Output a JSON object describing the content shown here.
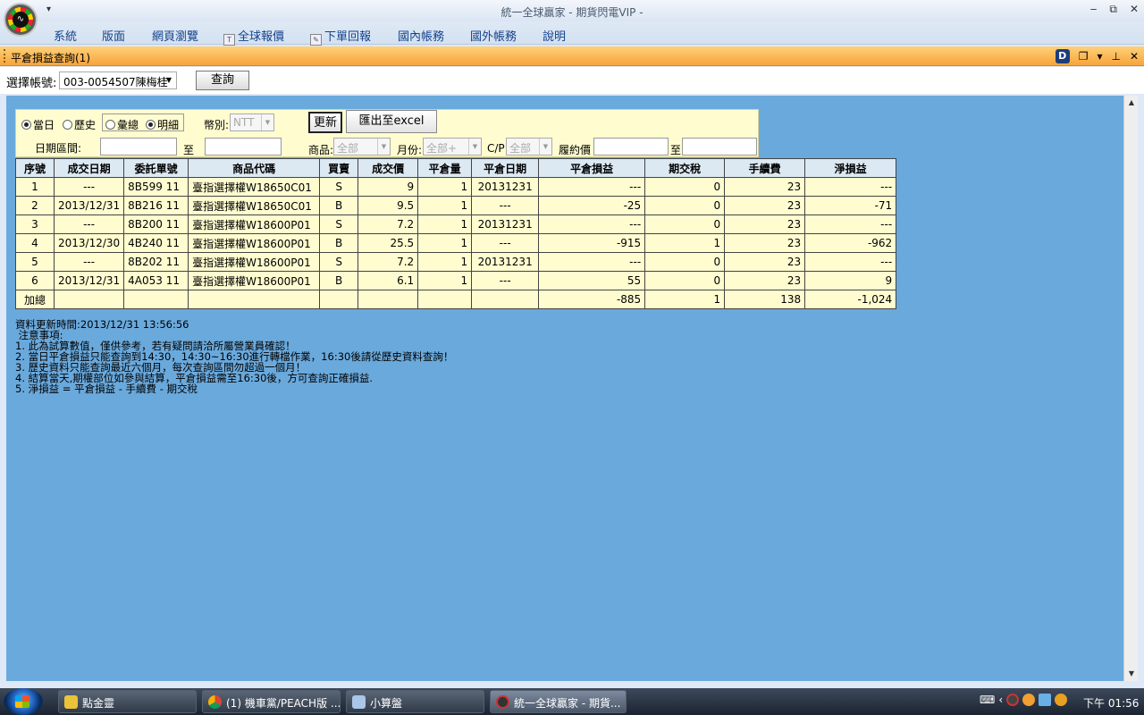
{
  "window": {
    "title": "統一全球贏家 - 期貨閃電VIP -",
    "qat_arrow": "▾",
    "controls": {
      "minimize": "‒",
      "restore": "⧉",
      "close": "✕"
    }
  },
  "menu": {
    "items": [
      "系統",
      "版面",
      "網頁瀏覽",
      "全球報價",
      "下單回報",
      "國內帳務",
      "國外帳務",
      "說明"
    ]
  },
  "panel": {
    "title": "平倉損益查詢(1)",
    "d_badge": "D",
    "controls": {
      "float": "❐",
      "menu": "▾",
      "pin": "⊥",
      "close": "✕"
    }
  },
  "account": {
    "label": "選擇帳號:",
    "selected": "003-0054507陳梅桂",
    "query_button": "查詢"
  },
  "filter": {
    "radio_today": "當日",
    "radio_history": "歷史",
    "radio_summary": "彙總",
    "radio_detail": "明細",
    "currency_label": "幣別:",
    "currency_value": "NTT",
    "update_button": "更新",
    "export_button": "匯出至excel",
    "date_range_label": "日期區間:",
    "to_label_1": "至",
    "product_label": "商品:",
    "product_value": "全部",
    "month_label": "月份:",
    "month_value": "全部+",
    "cp_label": "C/P",
    "cp_value": "全部",
    "strike_label": "履約價",
    "to_label_2": "至"
  },
  "table": {
    "headers": [
      "序號",
      "成交日期",
      "委託單號",
      "商品代碼",
      "買賣",
      "成交價",
      "平倉量",
      "平倉日期",
      "平倉損益",
      "期交稅",
      "手續費",
      "淨損益"
    ],
    "rows": [
      [
        "1",
        "---",
        "8B599 11",
        "臺指選擇權W18650C01",
        "S",
        "9",
        "1",
        "20131231",
        "---",
        "0",
        "23",
        "---"
      ],
      [
        "2",
        "2013/12/31",
        "8B216 11",
        "臺指選擇權W18650C01",
        "B",
        "9.5",
        "1",
        "---",
        "-25",
        "0",
        "23",
        "-71"
      ],
      [
        "3",
        "---",
        "8B200 11",
        "臺指選擇權W18600P01",
        "S",
        "7.2",
        "1",
        "20131231",
        "---",
        "0",
        "23",
        "---"
      ],
      [
        "4",
        "2013/12/30",
        "4B240 11",
        "臺指選擇權W18600P01",
        "B",
        "25.5",
        "1",
        "---",
        "-915",
        "1",
        "23",
        "-962"
      ],
      [
        "5",
        "---",
        "8B202 11",
        "臺指選擇權W18600P01",
        "S",
        "7.2",
        "1",
        "20131231",
        "---",
        "0",
        "23",
        "---"
      ],
      [
        "6",
        "2013/12/31",
        "4A053 11",
        "臺指選擇權W18600P01",
        "B",
        "6.1",
        "1",
        "---",
        "55",
        "0",
        "23",
        "9"
      ]
    ],
    "total": [
      "加總",
      "",
      "",
      "",
      "",
      "",
      "",
      "",
      "-885",
      "1",
      "138",
      "-1,024"
    ]
  },
  "notes": {
    "update_time": "資料更新時間:2013/12/31 13:56:56",
    "heading": " 注意事項:",
    "lines": [
      "1. 此為試算數值，僅供參考，若有疑問請洽所屬營業員確認！",
      "2. 當日平倉損益只能查詢到14:30，14:30~16:30進行轉檔作業，16:30後請從歷史資料查詢！",
      "3. 歷史資料只能查詢最近六個月，每次查詢區間勿超過一個月！",
      "4. 結算當天,期權部位如參與結算，平倉損益需至16:30後，方可查詢正確損益.",
      "5. 淨損益 = 平倉損益 - 手續費 - 期交稅"
    ]
  },
  "taskbar": {
    "tasks": [
      "點金靈",
      "(1) 機車黨/PEACH版 ...",
      "小算盤",
      "統一全球贏家 - 期貨..."
    ],
    "clock": "下午 01:56"
  }
}
